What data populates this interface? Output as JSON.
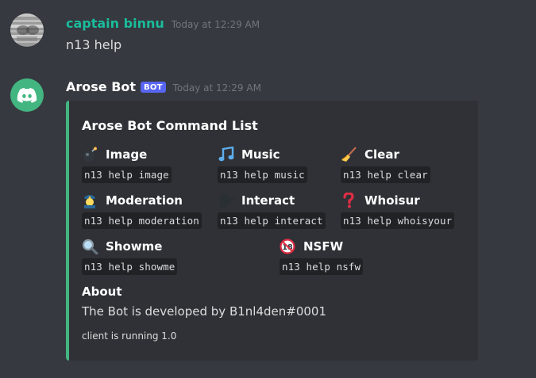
{
  "colors": {
    "background": "#36393f",
    "embed_bg": "#2f3136",
    "embed_accent": "#43b581",
    "user1_name": "#1abc9c",
    "bot_name": "#ffffff",
    "bot_badge": "#5865f2"
  },
  "messages": [
    {
      "username": "captain binnu",
      "timestamp": "Today at 12:29 AM",
      "content": "n13 help",
      "avatar_icon": "user-avatar"
    },
    {
      "username": "Arose Bot",
      "badge": "BOT",
      "timestamp": "Today at 12:29 AM",
      "avatar_icon": "discord-logo-icon",
      "embed": {
        "title": "Arose Bot Command List",
        "fields": [
          {
            "icon": "bomb-icon",
            "name": "Image",
            "value": "n13 help image"
          },
          {
            "icon": "music-note-icon",
            "name": "Music",
            "value": "n13 help music"
          },
          {
            "icon": "broom-icon",
            "name": "Clear",
            "value": "n13 help clear"
          },
          {
            "icon": "police-officer-icon",
            "name": "Moderation",
            "value": "n13 help moderation"
          },
          {
            "icon": "speaking-head-icon",
            "name": "Interact",
            "value": "n13 help interact"
          },
          {
            "icon": "question-mark-icon",
            "name": "Whoisur",
            "value": "n13 help whoisyour"
          },
          {
            "icon": "magnifier-icon",
            "name": "Showme",
            "value": "n13 help showme"
          },
          {
            "icon": "no-under-18-icon",
            "name": "NSFW",
            "value": "n13 help nsfw"
          }
        ],
        "about": {
          "name": "About",
          "value": "The Bot is developed by B1nl4den#0001"
        },
        "footer": "client is running 1.0"
      }
    }
  ]
}
